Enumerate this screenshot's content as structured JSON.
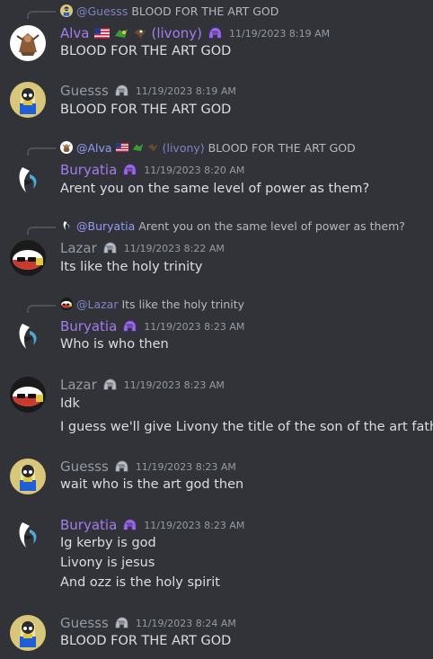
{
  "messages": [
    {
      "reply": {
        "mention": "@Guesss",
        "text": "BLOOD FOR THE ART GOD"
      },
      "author": "Alva",
      "author_suffix": "(livony)",
      "timestamp": "11/19/2023 8:19 AM",
      "lines": [
        "BLOOD FOR THE ART GOD"
      ]
    },
    {
      "author": "Guesss",
      "timestamp": "11/19/2023 8:19 AM",
      "lines": [
        "BLOOD FOR THE ART GOD"
      ]
    },
    {
      "reply": {
        "mention": "@Alva",
        "suffix": "(livony)",
        "text": "BLOOD FOR THE ART GOD"
      },
      "author": "Buryatia",
      "timestamp": "11/19/2023 8:20 AM",
      "lines": [
        "Arent you on the same level of power as them?"
      ]
    },
    {
      "reply": {
        "mention": "@Buryatia",
        "text": "Arent you on the same level of power as them?"
      },
      "author": "Lazar",
      "timestamp": "11/19/2023 8:22 AM",
      "lines": [
        "Its like the holy trinity"
      ]
    },
    {
      "reply": {
        "mention": "@Lazar",
        "text": "Its like the holy trinity"
      },
      "author": "Buryatia",
      "timestamp": "11/19/2023 8:23 AM",
      "lines": [
        "Who is who then"
      ]
    },
    {
      "author": "Lazar",
      "timestamp": "11/19/2023 8:23 AM",
      "lines": [
        "Idk",
        "I guess we'll give Livony the title of the son of the art father"
      ]
    },
    {
      "author": "Guesss",
      "timestamp": "11/19/2023 8:23 AM",
      "lines": [
        "wait who is the art god then"
      ]
    },
    {
      "author": "Buryatia",
      "timestamp": "11/19/2023 8:23 AM",
      "lines": [
        "Ig kerby is god",
        "Livony is jesus",
        "And ozz is the holy spirit"
      ]
    },
    {
      "author": "Guesss",
      "timestamp": "11/19/2023 8:24 AM",
      "lines": [
        "BLOOD FOR THE ART GOD"
      ]
    }
  ],
  "icons": {
    "role_icon_grey": "helmet-role-icon",
    "role_icon_purple": "purple-helmet-role-icon",
    "flag": "us-flag-icon"
  },
  "colors": {
    "background": "#313338",
    "text": "#dbdee1",
    "muted": "#949ba4",
    "purple_name": "#a37ded",
    "mention": "#949cf7"
  }
}
